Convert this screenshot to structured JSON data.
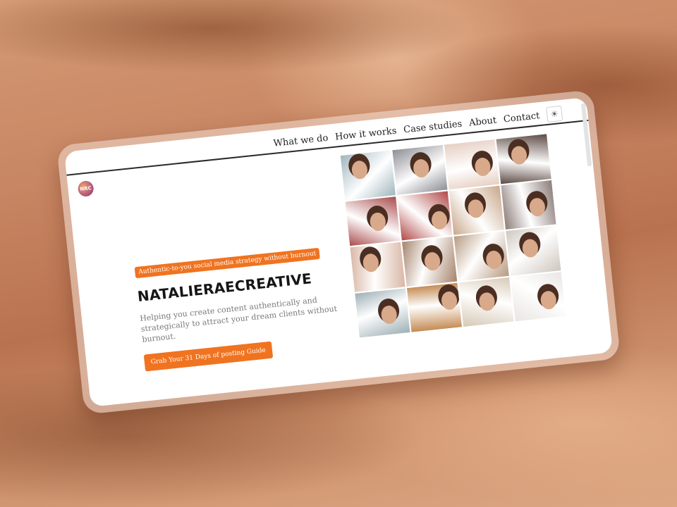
{
  "nav": {
    "items": [
      {
        "label": "What we do",
        "active": true
      },
      {
        "label": "How it works",
        "active": false
      },
      {
        "label": "Case studies",
        "active": false
      },
      {
        "label": "About",
        "active": false
      },
      {
        "label": "Contact",
        "active": false
      }
    ],
    "theme_toggle_icon": "sun-icon"
  },
  "logo": {
    "text": "NRC",
    "icon": "brand-logo-icon"
  },
  "hero": {
    "tagline": "Authentic-to-you social media strategy without burnout",
    "brand": "NATALIERAECREATIVE",
    "description": "Helping you create content authentically and strategically to attract your dream clients without burnout.",
    "cta_label": "Grab Your 31 Days of posting Guide"
  },
  "colors": {
    "accent": "#f07320",
    "highlight_start": "#e6477f",
    "highlight_end": "#f7a064",
    "nav_highlight": "#f7b47d",
    "background_sand": "#c88663"
  },
  "gallery": {
    "photos": [
      {
        "tone": "#9fb6bd"
      },
      {
        "tone": "#8e8f96"
      },
      {
        "tone": "#e6cfc2"
      },
      {
        "tone": "#5c4a44"
      },
      {
        "tone": "#a94b4b"
      },
      {
        "tone": "#b24848"
      },
      {
        "tone": "#c9a88c"
      },
      {
        "tone": "#8c7d7a"
      },
      {
        "tone": "#d9b7a6"
      },
      {
        "tone": "#a5826a"
      },
      {
        "tone": "#b79a80"
      },
      {
        "tone": "#cfc6bf"
      },
      {
        "tone": "#9fb0b6"
      },
      {
        "tone": "#c48a52"
      },
      {
        "tone": "#d7c9b6"
      },
      {
        "tone": "#e9e6e2"
      }
    ]
  }
}
